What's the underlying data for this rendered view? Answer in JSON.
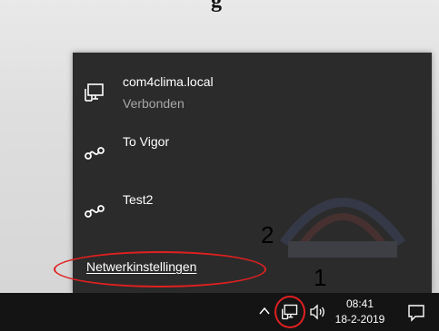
{
  "top_text": "g",
  "networks": [
    {
      "name": "com4clima.local",
      "status": "Verbonden",
      "icon": "ethernet-icon"
    },
    {
      "name": "To Vigor",
      "status": "",
      "icon": "dialup-icon"
    },
    {
      "name": "Test2",
      "status": "",
      "icon": "dialup-icon"
    }
  ],
  "settings_link": "Netwerkinstellingen",
  "annotations": {
    "one": "1",
    "two": "2"
  },
  "taskbar": {
    "time": "08:41",
    "date": "18-2-2019",
    "icons": [
      "chevron-up-icon",
      "network-icon",
      "volume-icon",
      "notification-icon"
    ]
  },
  "colors": {
    "flyout_bg": "#2b2b2b",
    "taskbar_bg": "#141414",
    "annotation_red": "#e02020",
    "status_gray": "#a8a8a8"
  }
}
